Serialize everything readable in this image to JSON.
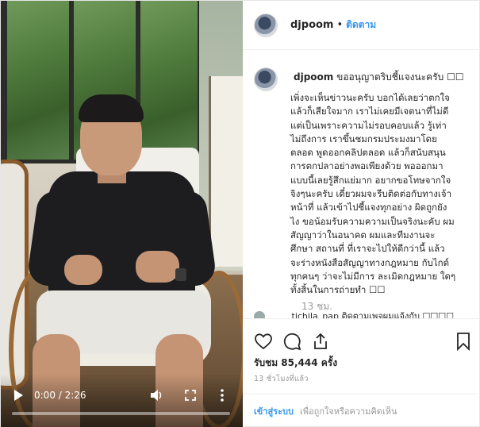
{
  "header": {
    "username": "djpoom",
    "separator": "•",
    "follow_label": "ติดตาม"
  },
  "caption": {
    "username": "djpoom",
    "title": "ขออนุญาตริบชี้แจงนะครับ ☐☐",
    "lines": [
      "เพิ่งจะเห็นข่าวนะครับ บอกได้เลยว่าตกใจ",
      "แล้วก็เสียใจมาก เราไม่เคยมีเจตนาที่ไม่ดี",
      "แต่เป็นเพราะความไม่รอบคอบแล้ว รู้เท่า",
      "ไม่ถึงการ เราขึ้นชมกรมประมงมาโดย",
      "ตลอด พูดออกคลิปตลอด แล้วก็สนับสนุน",
      "การตกปลาอย่างพอเพียงด้วย พอออกมา",
      "แบบนี้เลยรู้สึกแย่มาก อยากขอโทษจากใจ",
      "จิงๆนะครับ เดี๋ยวผมจะรีบติดต่อกับทางเจ้า",
      "หน้าที่ แล้วเข้าไปชี้แจงทุกอย่าง ผิดถูกยัง",
      "ไง ขอน้อมรับความความเป็นจริงนะคับ ผม",
      "สัญญาว่าในอนาคต ผมและทีมงานจะ",
      "ศึกษา สถานที่ ที่เราจะไปให้ดีกว่านี้ แล้ว",
      "จะร่างหนังสือสัญญาทางกฎหมาย กับไกด์",
      "ทุกคนๆ ว่าจะไม่มีการ ละเมิดกฎหมาย ใดๆ",
      "ทั้งสิ้นในการถ่ายทำ ☐☐"
    ],
    "time": "13 ชม."
  },
  "next_comment": {
    "text": "tichila_pap ติดตามเพจผมแจ้งกับ ☐☐☐☐"
  },
  "video": {
    "time_display": "0:00 / 2:26",
    "progress": 0.0
  },
  "icons": {
    "like": "heart-icon",
    "comment": "comment-icon",
    "share": "share-icon",
    "save": "bookmark-icon",
    "play": "play-icon",
    "volume": "volume-icon",
    "fullscreen": "fullscreen-icon",
    "more": "more-vertical-icon"
  },
  "stats": {
    "likes": "รับชม 85,444 ครั้ง",
    "ago": "13 ชั่วโมงที่แล้ว"
  },
  "footer": {
    "login_label": "เข้าสู่ระบบ",
    "hint": "เพื่อถูกใจหรือความคิดเห็น"
  },
  "colors": {
    "link": "#3897f0",
    "text": "#262626",
    "muted": "#999999",
    "border": "#efefef"
  }
}
